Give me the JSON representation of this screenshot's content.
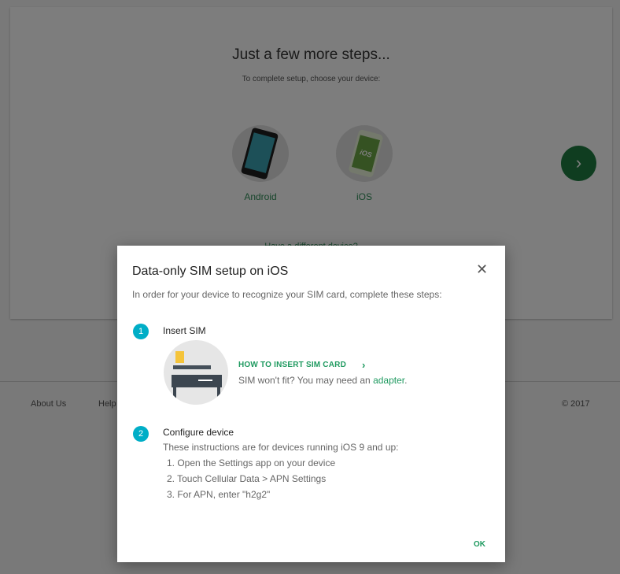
{
  "setup": {
    "title": "Just a few more steps...",
    "subtitle": "To complete setup, choose your device:",
    "devices": [
      {
        "label": "Android",
        "screen_text": ""
      },
      {
        "label": "iOS",
        "screen_text": "iOS"
      }
    ],
    "next_icon": "chevron-right-icon",
    "different_device": "Have a different device?"
  },
  "footer": {
    "about": "About Us",
    "help": "Help",
    "copyright": "© 2017"
  },
  "dialog": {
    "title": "Data-only SIM setup on iOS",
    "close_symbol": "✕",
    "intro": "In order for your device to recognize your SIM card, complete these steps:",
    "step1": {
      "number": "1",
      "title": "Insert SIM",
      "link_label": "HOW TO INSERT SIM CARD",
      "link_chevron": "›",
      "note_prefix": "SIM won't fit? You may need an ",
      "note_link": "adapter",
      "note_suffix": "."
    },
    "step2": {
      "number": "2",
      "title": "Configure device",
      "intro": "These instructions are for devices running iOS 9 and up:",
      "items": [
        "1. Open the Settings app on your device",
        "2. Touch Cellular Data > APN Settings",
        "3. For APN, enter \"h2g2\""
      ]
    },
    "ok_label": "OK"
  },
  "colors": {
    "accent_green": "#1f9a60",
    "next_button": "#1f7a40",
    "step_badge": "#00aec7",
    "scrim": "rgba(0,0,0,0.5)"
  }
}
